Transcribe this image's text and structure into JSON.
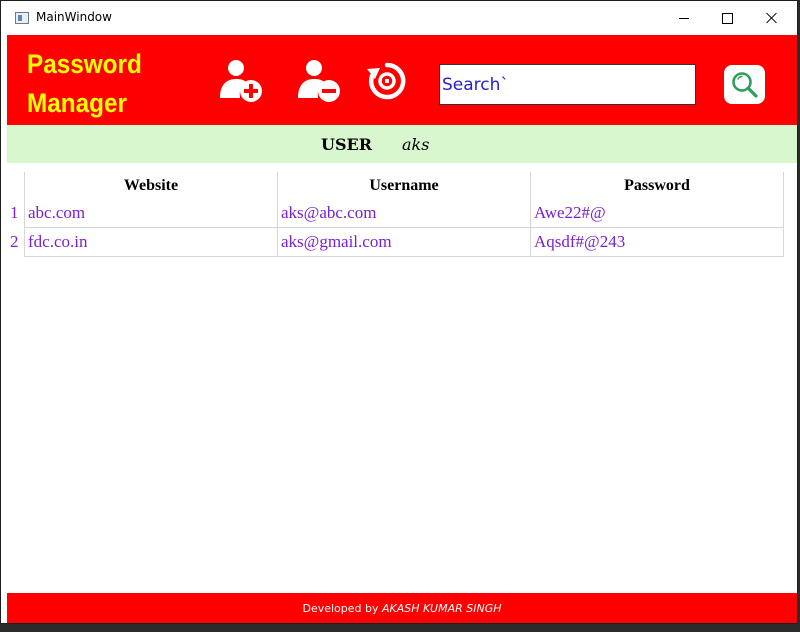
{
  "window": {
    "title": "MainWindow"
  },
  "header": {
    "title_line1": "Password",
    "title_line2": "Manager",
    "icons": [
      "add-user-icon",
      "remove-user-icon",
      "reset-icon",
      "search-icon"
    ],
    "search": {
      "value": "Search`",
      "placeholder": ""
    },
    "colors": {
      "background": "#ff0000",
      "title": "#ffff00"
    }
  },
  "userbar": {
    "label": "USER",
    "value": "aks",
    "background": "#d9f7cf"
  },
  "table": {
    "columns": [
      "Website",
      "Username",
      "Password"
    ],
    "rows": [
      {
        "num": "1",
        "website": "abc.com",
        "username": "aks@abc.com",
        "password": "Awe22#@"
      },
      {
        "num": "2",
        "website": "fdc.co.in",
        "username": "aks@gmail.com",
        "password": "Aqsdf#@243"
      }
    ],
    "cell_color": "#7b1fcf"
  },
  "footer": {
    "text_prefix": "Developed by ",
    "author": "AKASH KUMAR SINGH"
  }
}
